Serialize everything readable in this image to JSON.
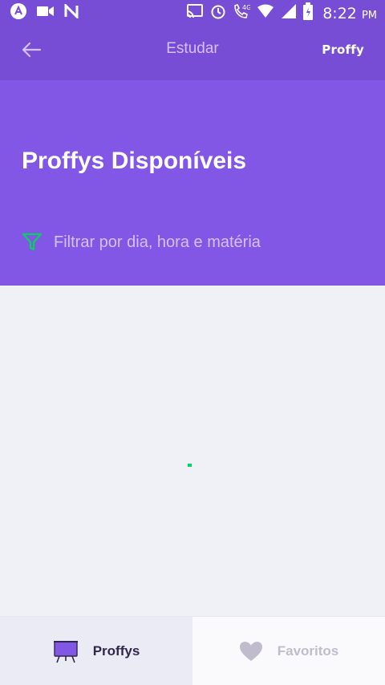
{
  "status_bar": {
    "time": "8:22",
    "ampm": "PM",
    "network": "4G",
    "icons": [
      "react-native-icon",
      "video-camera-icon",
      "n-icon",
      "cast-icon",
      "alarm-icon",
      "phone-icon",
      "wifi-icon",
      "signal-icon",
      "battery-icon"
    ]
  },
  "topbar": {
    "back_icon": "arrow-left-icon",
    "title": "Estudar",
    "logo": "Proffy"
  },
  "header": {
    "title": "Proffys Disponíveis",
    "filter_label": "Filtrar por dia, hora e matéria",
    "filter_icon": "filter-icon"
  },
  "tabs": [
    {
      "label": "Proffys",
      "icon": "easel-icon",
      "active": true
    },
    {
      "label": "Favoritos",
      "icon": "heart-icon",
      "active": false
    }
  ],
  "colors": {
    "primary": "#8257e5",
    "primary_dark": "#774dd6",
    "accent_green": "#04d361",
    "background": "#f0f0f7"
  }
}
